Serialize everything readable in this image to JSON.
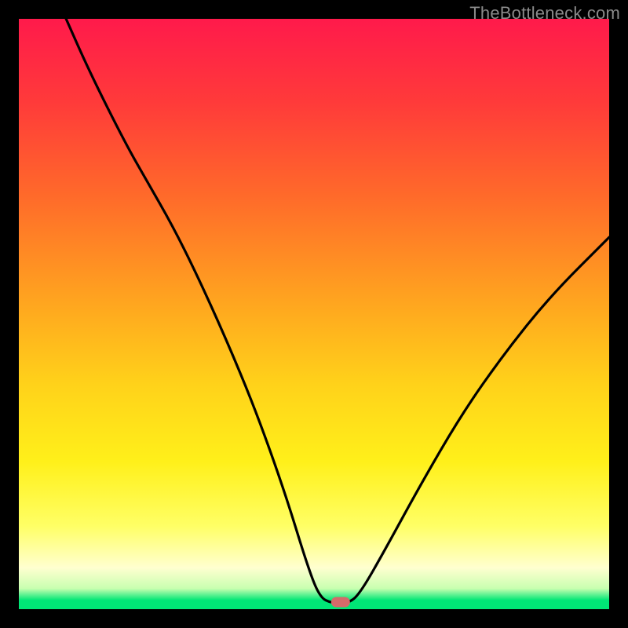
{
  "watermark": "TheBottleneck.com",
  "chart_data": {
    "type": "line",
    "title": "",
    "xlabel": "",
    "ylabel": "",
    "xlim": [
      0,
      100
    ],
    "ylim": [
      0,
      100
    ],
    "gradient_stops": [
      {
        "offset": 0.0,
        "color": "#ff1a4b"
      },
      {
        "offset": 0.14,
        "color": "#ff3a3a"
      },
      {
        "offset": 0.3,
        "color": "#ff6a2a"
      },
      {
        "offset": 0.48,
        "color": "#ffa51f"
      },
      {
        "offset": 0.62,
        "color": "#ffd21a"
      },
      {
        "offset": 0.75,
        "color": "#fff01a"
      },
      {
        "offset": 0.86,
        "color": "#ffff66"
      },
      {
        "offset": 0.93,
        "color": "#ffffd0"
      },
      {
        "offset": 0.965,
        "color": "#c8ffb0"
      },
      {
        "offset": 0.985,
        "color": "#00e676"
      },
      {
        "offset": 1.0,
        "color": "#00e676"
      }
    ],
    "series": [
      {
        "name": "bottleneck-curve",
        "points": [
          {
            "x": 8,
            "y": 100
          },
          {
            "x": 12,
            "y": 91
          },
          {
            "x": 18,
            "y": 79
          },
          {
            "x": 22,
            "y": 72
          },
          {
            "x": 26,
            "y": 65
          },
          {
            "x": 30,
            "y": 57
          },
          {
            "x": 35,
            "y": 46
          },
          {
            "x": 40,
            "y": 34
          },
          {
            "x": 45,
            "y": 20
          },
          {
            "x": 49,
            "y": 7
          },
          {
            "x": 51,
            "y": 2
          },
          {
            "x": 53,
            "y": 1
          },
          {
            "x": 56,
            "y": 1
          },
          {
            "x": 58,
            "y": 3
          },
          {
            "x": 62,
            "y": 10
          },
          {
            "x": 68,
            "y": 21
          },
          {
            "x": 75,
            "y": 33
          },
          {
            "x": 82,
            "y": 43
          },
          {
            "x": 90,
            "y": 53
          },
          {
            "x": 100,
            "y": 63
          }
        ]
      }
    ],
    "marker": {
      "x": 54.5,
      "y": 1.2,
      "color": "#d46a6a"
    }
  }
}
